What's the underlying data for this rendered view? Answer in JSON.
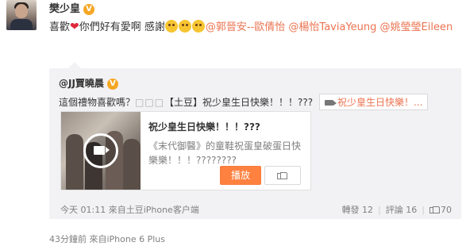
{
  "post": {
    "username": "樊少皇",
    "verified_badge": "V",
    "text_part1": "喜歡",
    "text_part2": "你們好有愛啊 感謝",
    "mentions": [
      "@郭晉安--歐倩怡",
      "@楊怡TaviaYeung",
      "@姚瑩瑩Eileen"
    ],
    "footer": "43分鐘前 來自iPhone 6 Plus"
  },
  "repost": {
    "author": "@JJ賈曉晨",
    "verified_badge": "V",
    "text": "這個禮物喜歡嗎？",
    "boxes": "□□□",
    "text_tag": "【土豆】祝少皇生日快樂！！！???",
    "video_link": "祝少皇生日快樂！...",
    "card": {
      "title": "祝少皇生日快樂！！！???",
      "description": "《末代御醫》的童鞋祝蛋皇破蛋日快樂樂！！！????????",
      "play_label": "播放"
    },
    "meta": "今天 01:11 來自土豆iPhone客户端",
    "forwards": "轉發 12",
    "comments": "評論 16",
    "likes": "70"
  },
  "colors": {
    "accent": "#eb7350",
    "play_button": "#ff8140",
    "verified": "#f5a623",
    "repost_bg": "#f2f2f5"
  }
}
